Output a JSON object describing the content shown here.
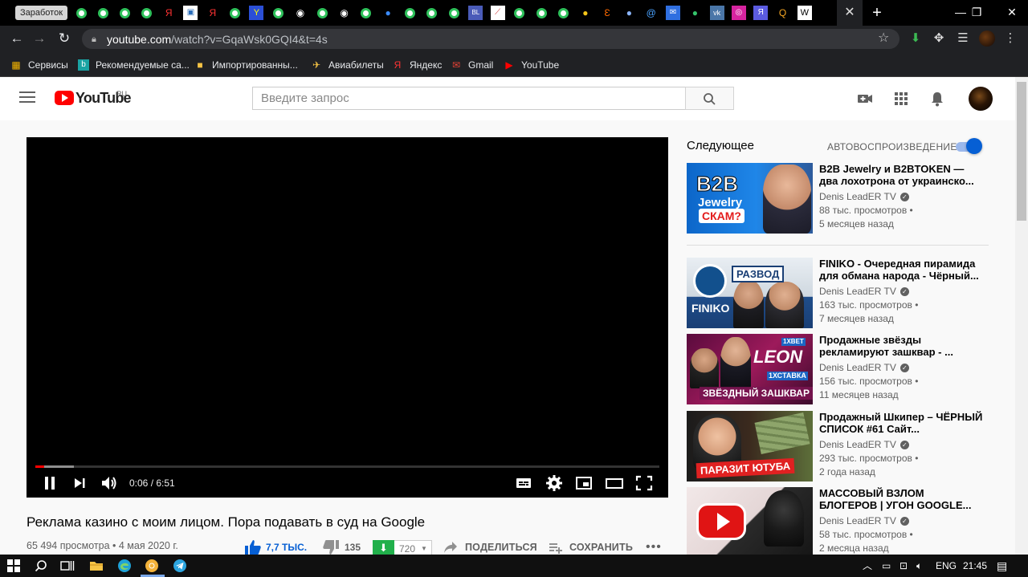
{
  "browser": {
    "first_tab_label": "Заработок",
    "url_domain": "youtube.com",
    "url_path": "/watch?v=GqaWsk0GQI4&t=4s",
    "bookmarks": [
      {
        "label": "Сервисы"
      },
      {
        "label": "Рекомендуемые са..."
      },
      {
        "label": "Импортированны..."
      },
      {
        "label": "Авиабилеты"
      },
      {
        "label": "Яндекс"
      },
      {
        "label": "Gmail"
      },
      {
        "label": "YouTube"
      }
    ]
  },
  "masthead": {
    "logo_text": "YouTube",
    "region": "RU",
    "search_placeholder": "Введите запрос"
  },
  "player": {
    "time": "0:06 / 6:51",
    "played_fraction": 0.0146,
    "loaded_fraction": 0.062
  },
  "video": {
    "title": "Реклама казино с моим лицом. Пора подавать в суд на Google",
    "meta": "65 494 просмотра • 4 мая 2020 г.",
    "likes": "7,7 ТЫС.",
    "dislikes": "135",
    "download_count": "720",
    "share_label": "ПОДЕЛИТЬСЯ",
    "save_label": "СОХРАНИТЬ",
    "more": "•••"
  },
  "sidebar": {
    "up_next": "Следующее",
    "autoplay": "АВТОВОСПРОИЗВЕДЕНИЕ",
    "autoplay_on": true,
    "items": [
      {
        "title": "B2B Jewelry и B2BTOKEN — два лохотрона от украинско...",
        "channel": "Denis LeadER TV",
        "views": "88 тыс. просмотров •",
        "age": "5 месяцев назад",
        "thumb_text": [
          "B2B",
          "Jewelry",
          "СКАМ?"
        ]
      },
      {
        "title": "FINIKO - Очередная пирамида для обмана народа - Чёрный...",
        "channel": "Denis LeadER TV",
        "views": "163 тыс. просмотров •",
        "age": "7 месяцев назад",
        "thumb_text": [
          "РАЗВОД",
          "FINIKO"
        ]
      },
      {
        "title": "Продажные звёзды рекламируют зашквар - ...",
        "channel": "Denis LeadER TV",
        "views": "156 тыс. просмотров •",
        "age": "11 месяцев назад",
        "thumb_text": [
          "1XBET",
          "LEON",
          "1ХСТАВКА",
          "ЗВЁЗДНЫЙ ЗАШКВАР"
        ]
      },
      {
        "title": "Продажный Шкипер – ЧЁРНЫЙ СПИСОК #61 Сайт...",
        "channel": "Denis LeadER TV",
        "views": "293 тыс. просмотров •",
        "age": "2 года назад",
        "thumb_text": [
          "ПАРАЗИТ ЮТУБА"
        ]
      },
      {
        "title": "МАССОВЫЙ ВЗЛОМ БЛОГЕРОВ | УГОН GOOGLE...",
        "channel": "Denis LeadER TV",
        "views": "58 тыс. просмотров •",
        "age": "2 месяца назад",
        "thumb_text": []
      }
    ]
  },
  "taskbar": {
    "language": "ENG",
    "clock": "21:45"
  },
  "colors": {
    "accent": "#065fd4",
    "youtube_red": "#ff0000",
    "download_green": "#21b04b",
    "chrome_dark": "#202124"
  }
}
